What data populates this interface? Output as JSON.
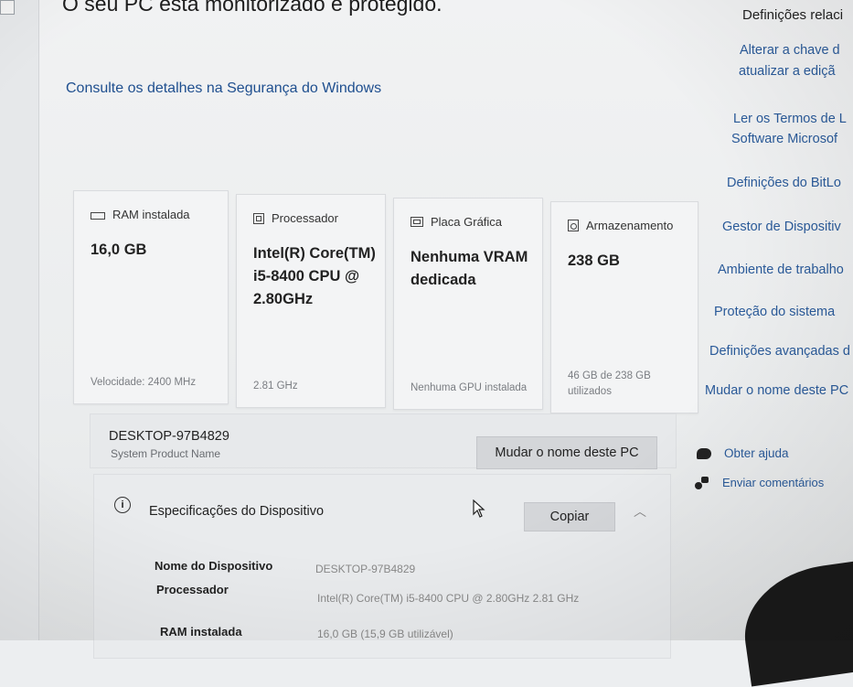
{
  "header": {
    "title": "O seu PC está monitorizado e protegido.",
    "security_link": "Consulte os detalhes na Segurança do Windows"
  },
  "related": {
    "heading": "Definições relaci",
    "links": [
      "Alterar a chave d",
      "atualizar a ediçã",
      "Ler os Termos de L",
      "Software Microsof",
      "Definições do BitLo",
      "Gestor de Dispositiv",
      "Ambiente de trabalho",
      "Proteção do sistema",
      "Definições avançadas d",
      "Mudar o nome deste PC"
    ]
  },
  "cards": [
    {
      "icon": "ram-icon",
      "label": "RAM instalada",
      "value": "16,0 GB",
      "footer": "Velocidade: 2400 MHz"
    },
    {
      "icon": "processor-icon",
      "label": "Processador",
      "value": "Intel(R) Core(TM) i5-8400 CPU @ 2.80GHz",
      "footer": "2.81 GHz"
    },
    {
      "icon": "graphics-card-icon",
      "label": "Placa Gráfica",
      "value": "Nenhuma VRAM dedicada",
      "footer": "Nenhuma GPU instalada"
    },
    {
      "icon": "storage-icon",
      "label": "Armazenamento",
      "value": "238 GB",
      "footer": "46 GB de 238 GB utilizados"
    }
  ],
  "device": {
    "name": "DESKTOP-97B4829",
    "subtitle": "System Product Name",
    "rename_button": "Mudar o nome deste PC"
  },
  "specs": {
    "title": "Especificações do Dispositivo",
    "copy_button": "Copiar",
    "rows": [
      {
        "label": "Nome do Dispositivo",
        "value": "DESKTOP-97B4829"
      },
      {
        "label": "Processador",
        "value": "Intel(R) Core(TM) i5-8400 CPU @ 2.80GHz   2.81 GHz"
      },
      {
        "label": "RAM instalada",
        "value": "16,0 GB (15,9 GB utilizável)"
      }
    ]
  },
  "help": {
    "get_help": "Obter ajuda",
    "feedback": "Enviar comentários"
  }
}
